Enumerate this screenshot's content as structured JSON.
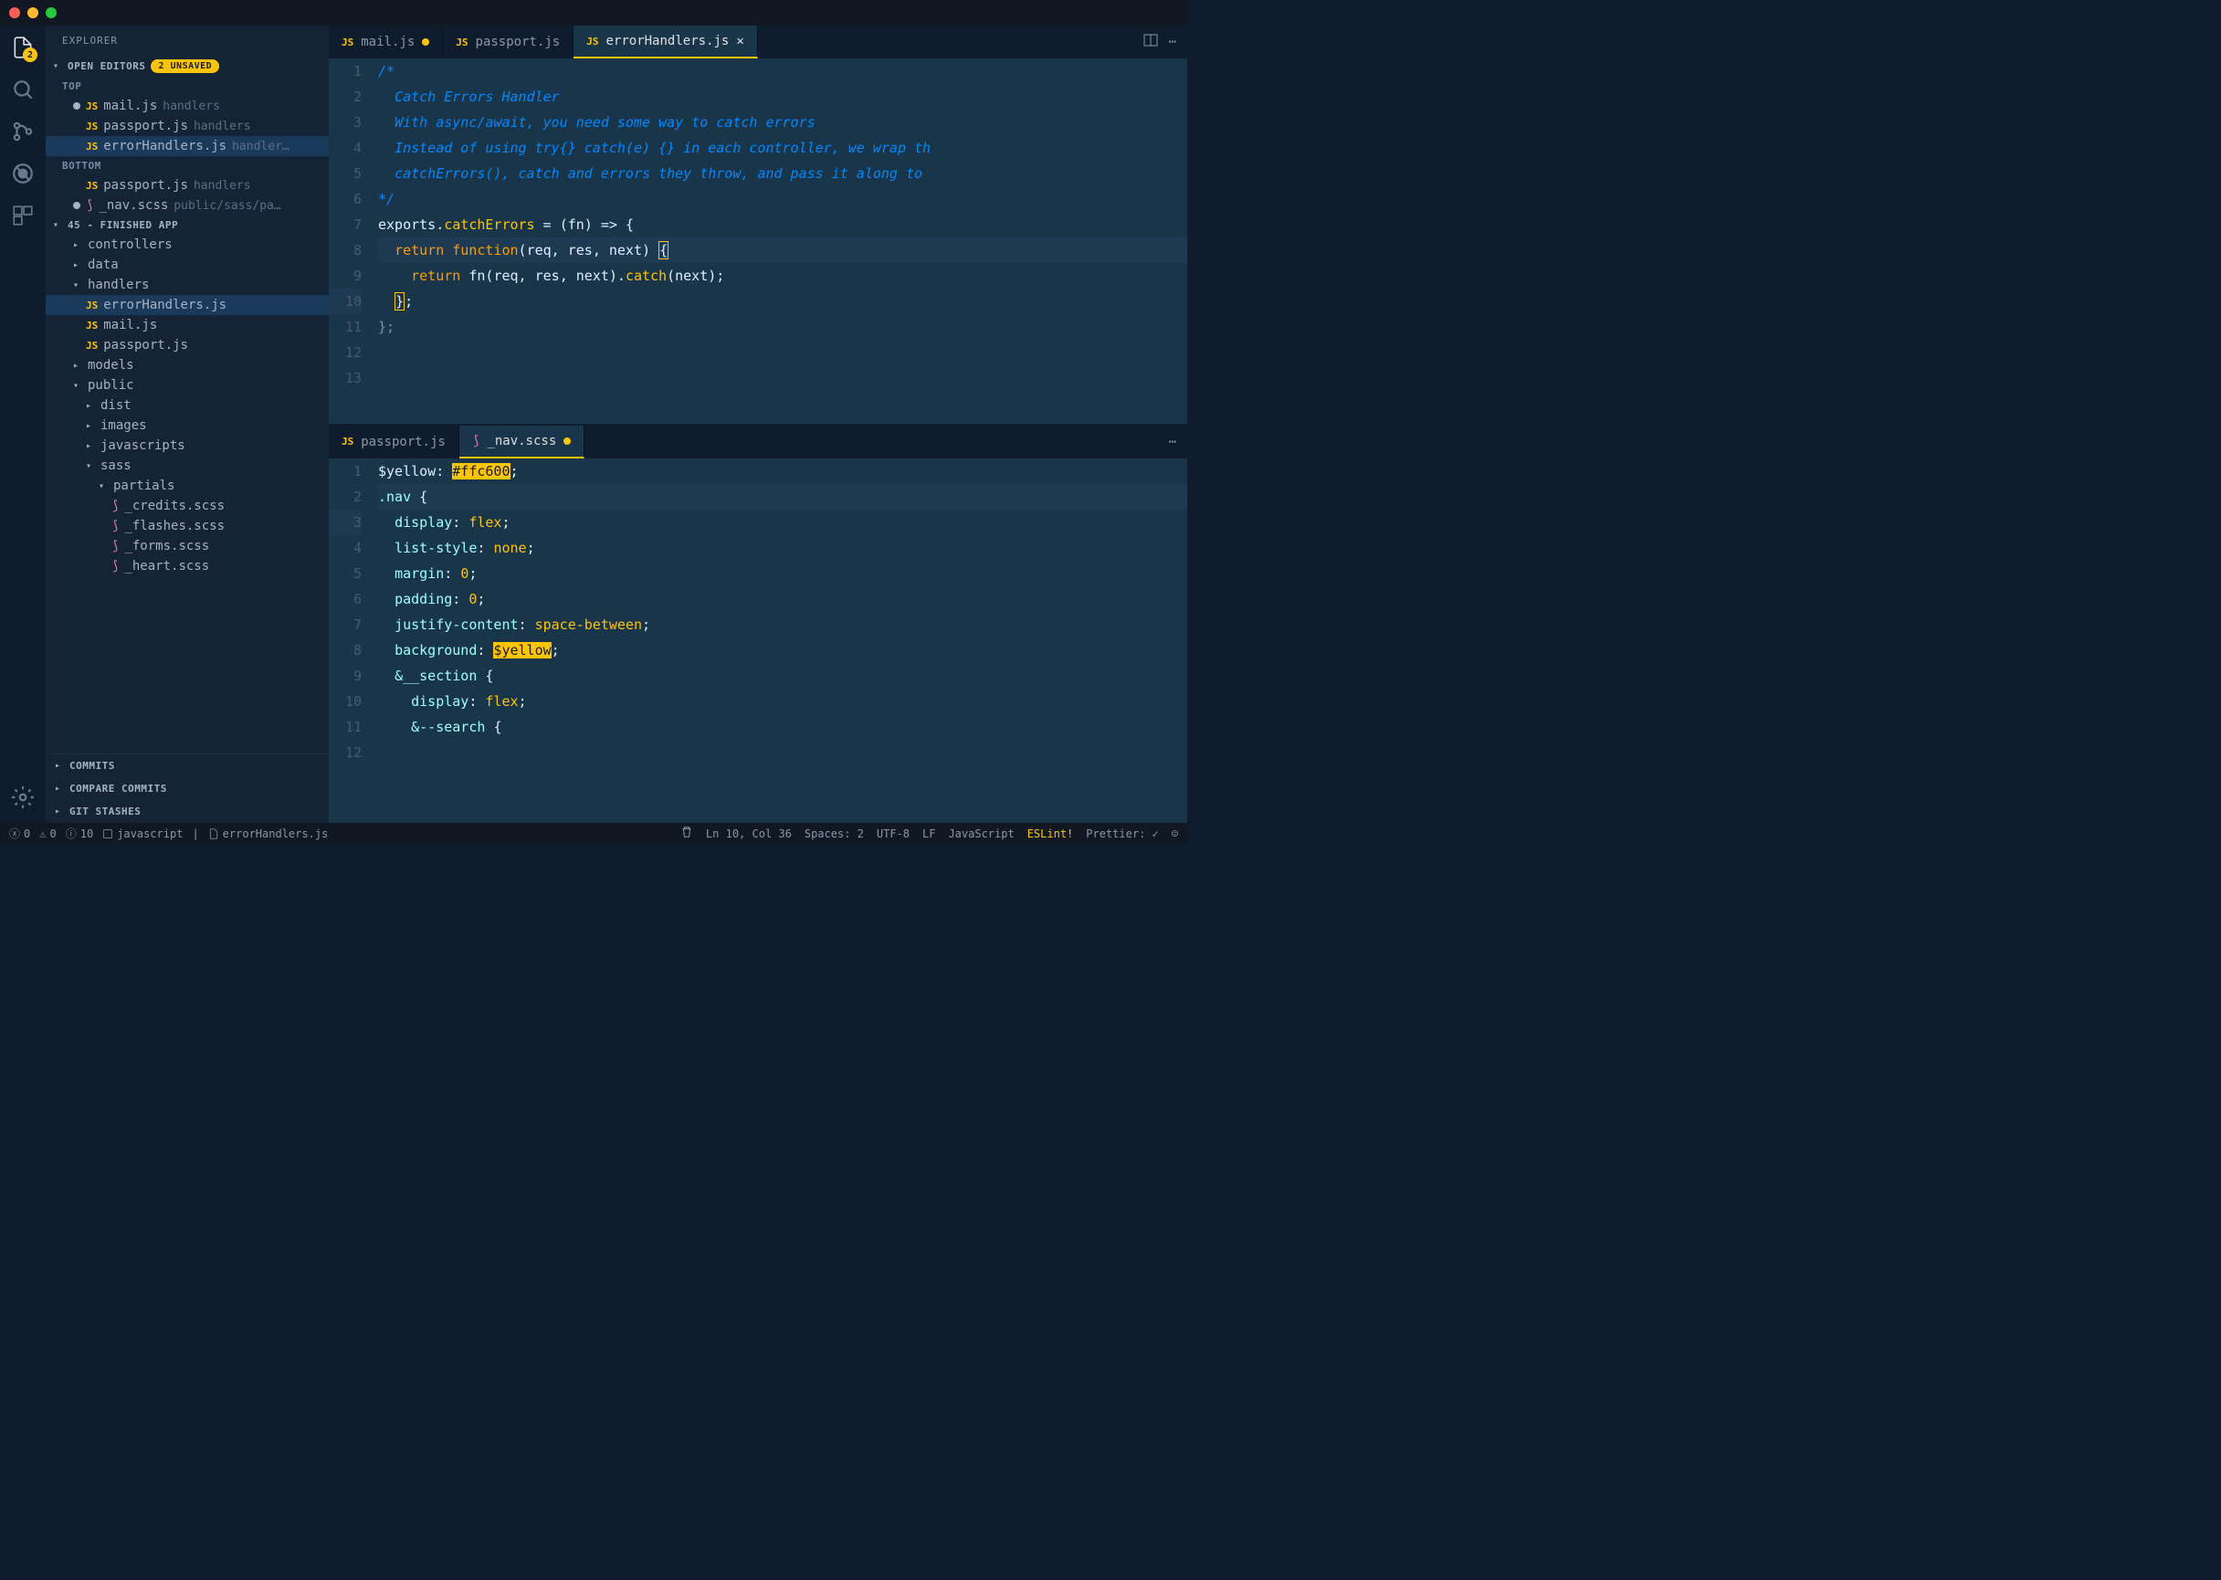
{
  "sidebar": {
    "title": "EXPLORER",
    "openEditors": {
      "label": "OPEN EDITORS",
      "unsavedBadge": "2 UNSAVED",
      "groups": [
        {
          "label": "TOP",
          "items": [
            {
              "icon": "js",
              "name": "mail.js",
              "dir": "handlers",
              "modified": true
            },
            {
              "icon": "js",
              "name": "passport.js",
              "dir": "handlers",
              "modified": false
            },
            {
              "icon": "js",
              "name": "errorHandlers.js",
              "dir": "handler…",
              "modified": false,
              "selected": true
            }
          ]
        },
        {
          "label": "BOTTOM",
          "items": [
            {
              "icon": "js",
              "name": "passport.js",
              "dir": "handlers",
              "modified": false
            },
            {
              "icon": "sass",
              "name": "_nav.scss",
              "dir": "public/sass/pa…",
              "modified": true
            }
          ]
        }
      ]
    },
    "project": {
      "label": "45 - FINISHED APP",
      "tree": [
        {
          "type": "folder",
          "name": "controllers",
          "expanded": false,
          "indent": 1
        },
        {
          "type": "folder",
          "name": "data",
          "expanded": false,
          "indent": 1
        },
        {
          "type": "folder",
          "name": "handlers",
          "expanded": true,
          "indent": 1
        },
        {
          "type": "file",
          "icon": "js",
          "name": "errorHandlers.js",
          "indent": 2,
          "selected": true
        },
        {
          "type": "file",
          "icon": "js",
          "name": "mail.js",
          "indent": 2
        },
        {
          "type": "file",
          "icon": "js",
          "name": "passport.js",
          "indent": 2
        },
        {
          "type": "folder",
          "name": "models",
          "expanded": false,
          "indent": 1
        },
        {
          "type": "folder",
          "name": "public",
          "expanded": true,
          "indent": 1
        },
        {
          "type": "folder",
          "name": "dist",
          "expanded": false,
          "indent": 2
        },
        {
          "type": "folder",
          "name": "images",
          "expanded": false,
          "indent": 2
        },
        {
          "type": "folder",
          "name": "javascripts",
          "expanded": false,
          "indent": 2
        },
        {
          "type": "folder",
          "name": "sass",
          "expanded": true,
          "indent": 2
        },
        {
          "type": "folder",
          "name": "partials",
          "expanded": true,
          "indent": 3
        },
        {
          "type": "file",
          "icon": "sass",
          "name": "_credits.scss",
          "indent": 4
        },
        {
          "type": "file",
          "icon": "sass",
          "name": "_flashes.scss",
          "indent": 4
        },
        {
          "type": "file",
          "icon": "sass",
          "name": "_forms.scss",
          "indent": 4
        },
        {
          "type": "file",
          "icon": "sass",
          "name": "_heart.scss",
          "indent": 4
        }
      ]
    },
    "bottomPanels": [
      "COMMITS",
      "COMPARE COMMITS",
      "GIT STASHES"
    ]
  },
  "activityBadge": "2",
  "topEditor": {
    "tabs": [
      {
        "icon": "js",
        "name": "mail.js",
        "modified": true,
        "active": false
      },
      {
        "icon": "js",
        "name": "passport.js",
        "modified": false,
        "active": false
      },
      {
        "icon": "js",
        "name": "errorHandlers.js",
        "modified": false,
        "active": true
      }
    ],
    "lines": [
      {
        "n": "1",
        "cls": "",
        "html": "<span class='tok-comment'>/*</span>"
      },
      {
        "n": "2",
        "cls": "",
        "html": "  <span class='tok-comment'>Catch Errors Handler</span>"
      },
      {
        "n": "3",
        "cls": "",
        "html": ""
      },
      {
        "n": "4",
        "cls": "",
        "html": "  <span class='tok-comment'>With async/await, you need some way to catch errors</span>"
      },
      {
        "n": "5",
        "cls": "",
        "html": "  <span class='tok-comment'>Instead of using try{} catch(e) {} in each controller, we wrap th</span>"
      },
      {
        "n": "6",
        "cls": "",
        "html": "  <span class='tok-comment'>catchErrors(), catch and errors they throw, and pass it along to </span>"
      },
      {
        "n": "7",
        "cls": "",
        "html": "<span class='tok-comment'>*/</span>"
      },
      {
        "n": "8",
        "cls": "",
        "html": ""
      },
      {
        "n": "9",
        "cls": "",
        "html": "<span class='tok-var'>exports</span><span class='tok-punc'>.</span><span class='tok-func'>catchErrors</span> <span class='tok-punc'>=</span> <span class='tok-punc'>(</span><span class='tok-var'>fn</span><span class='tok-punc'>)</span> <span class='tok-punc'>=&gt;</span> <span class='tok-punc'>{</span>"
      },
      {
        "n": "10",
        "cls": "current",
        "html": "  <span class='tok-keyword'>return</span> <span class='tok-keyword'>function</span><span class='tok-punc'>(</span><span class='tok-var'>req</span><span class='tok-punc'>,</span> <span class='tok-var'>res</span><span class='tok-punc'>,</span> <span class='tok-var'>next</span><span class='tok-punc'>)</span> <span class='tok-punc bracket-match'>{</span>"
      },
      {
        "n": "11",
        "cls": "",
        "html": "    <span class='tok-keyword'>return</span> <span class='tok-var'>fn</span><span class='tok-punc'>(</span><span class='tok-var'>req</span><span class='tok-punc'>,</span> <span class='tok-var'>res</span><span class='tok-punc'>,</span> <span class='tok-var'>next</span><span class='tok-punc'>).</span><span class='tok-func'>catch</span><span class='tok-punc'>(</span><span class='tok-var'>next</span><span class='tok-punc'>);</span>"
      },
      {
        "n": "12",
        "cls": "",
        "html": "  <span class='tok-punc bracket-match'>}</span><span class='tok-punc'>;</span>"
      },
      {
        "n": "13",
        "cls": "",
        "html": "<span class='tok-punc' style='opacity:.5'>};</span>"
      }
    ]
  },
  "bottomEditor": {
    "tabs": [
      {
        "icon": "js",
        "name": "passport.js",
        "modified": false,
        "active": false
      },
      {
        "icon": "sass",
        "name": "_nav.scss",
        "modified": true,
        "active": true
      }
    ],
    "lines": [
      {
        "n": "1",
        "cls": "",
        "html": "<span class='tok-var'>$yellow</span><span class='tok-punc'>:</span> <span class='tok-yellow-bg'>#ffc600</span><span class='tok-punc'>;</span>"
      },
      {
        "n": "2",
        "cls": "",
        "html": ""
      },
      {
        "n": "3",
        "cls": "current",
        "html": "<span class='tok-sel'>.nav</span> <span class='tok-punc'>{</span>"
      },
      {
        "n": "4",
        "cls": "",
        "html": "  <span class='tok-prop'>display</span><span class='tok-punc'>:</span> <span class='tok-val'>flex</span><span class='tok-punc'>;</span>"
      },
      {
        "n": "5",
        "cls": "",
        "html": "  <span class='tok-prop'>list-style</span><span class='tok-punc'>:</span> <span class='tok-val'>none</span><span class='tok-punc'>;</span>"
      },
      {
        "n": "6",
        "cls": "",
        "html": "  <span class='tok-prop'>margin</span><span class='tok-punc'>:</span> <span class='tok-val'>0</span><span class='tok-punc'>;</span>"
      },
      {
        "n": "7",
        "cls": "",
        "html": "  <span class='tok-prop'>padding</span><span class='tok-punc'>:</span> <span class='tok-val'>0</span><span class='tok-punc'>;</span>"
      },
      {
        "n": "8",
        "cls": "",
        "html": "  <span class='tok-prop'>justify-content</span><span class='tok-punc'>:</span> <span class='tok-val'>space-between</span><span class='tok-punc'>;</span>"
      },
      {
        "n": "9",
        "cls": "",
        "html": "  <span class='tok-prop'>background</span><span class='tok-punc'>:</span> <span class='tok-yellow-bg'>$yellow</span><span class='tok-punc'>;</span>"
      },
      {
        "n": "10",
        "cls": "",
        "html": "  <span class='tok-sel'>&amp;__section</span> <span class='tok-punc'>{</span>"
      },
      {
        "n": "11",
        "cls": "",
        "html": "    <span class='tok-prop'>display</span><span class='tok-punc'>:</span> <span class='tok-val'>flex</span><span class='tok-punc'>;</span>"
      },
      {
        "n": "12",
        "cls": "",
        "html": "    <span class='tok-sel'>&amp;--search</span> <span class='tok-punc'>{</span>"
      }
    ]
  },
  "statusBar": {
    "errors": "0",
    "warnings": "0",
    "info": "10",
    "language": "javascript",
    "file": "errorHandlers.js",
    "position": "Ln 10, Col 36",
    "spaces": "Spaces: 2",
    "encoding": "UTF-8",
    "eol": "LF",
    "langMode": "JavaScript",
    "eslint": "ESLint!",
    "prettier": "Prettier: ✓"
  }
}
